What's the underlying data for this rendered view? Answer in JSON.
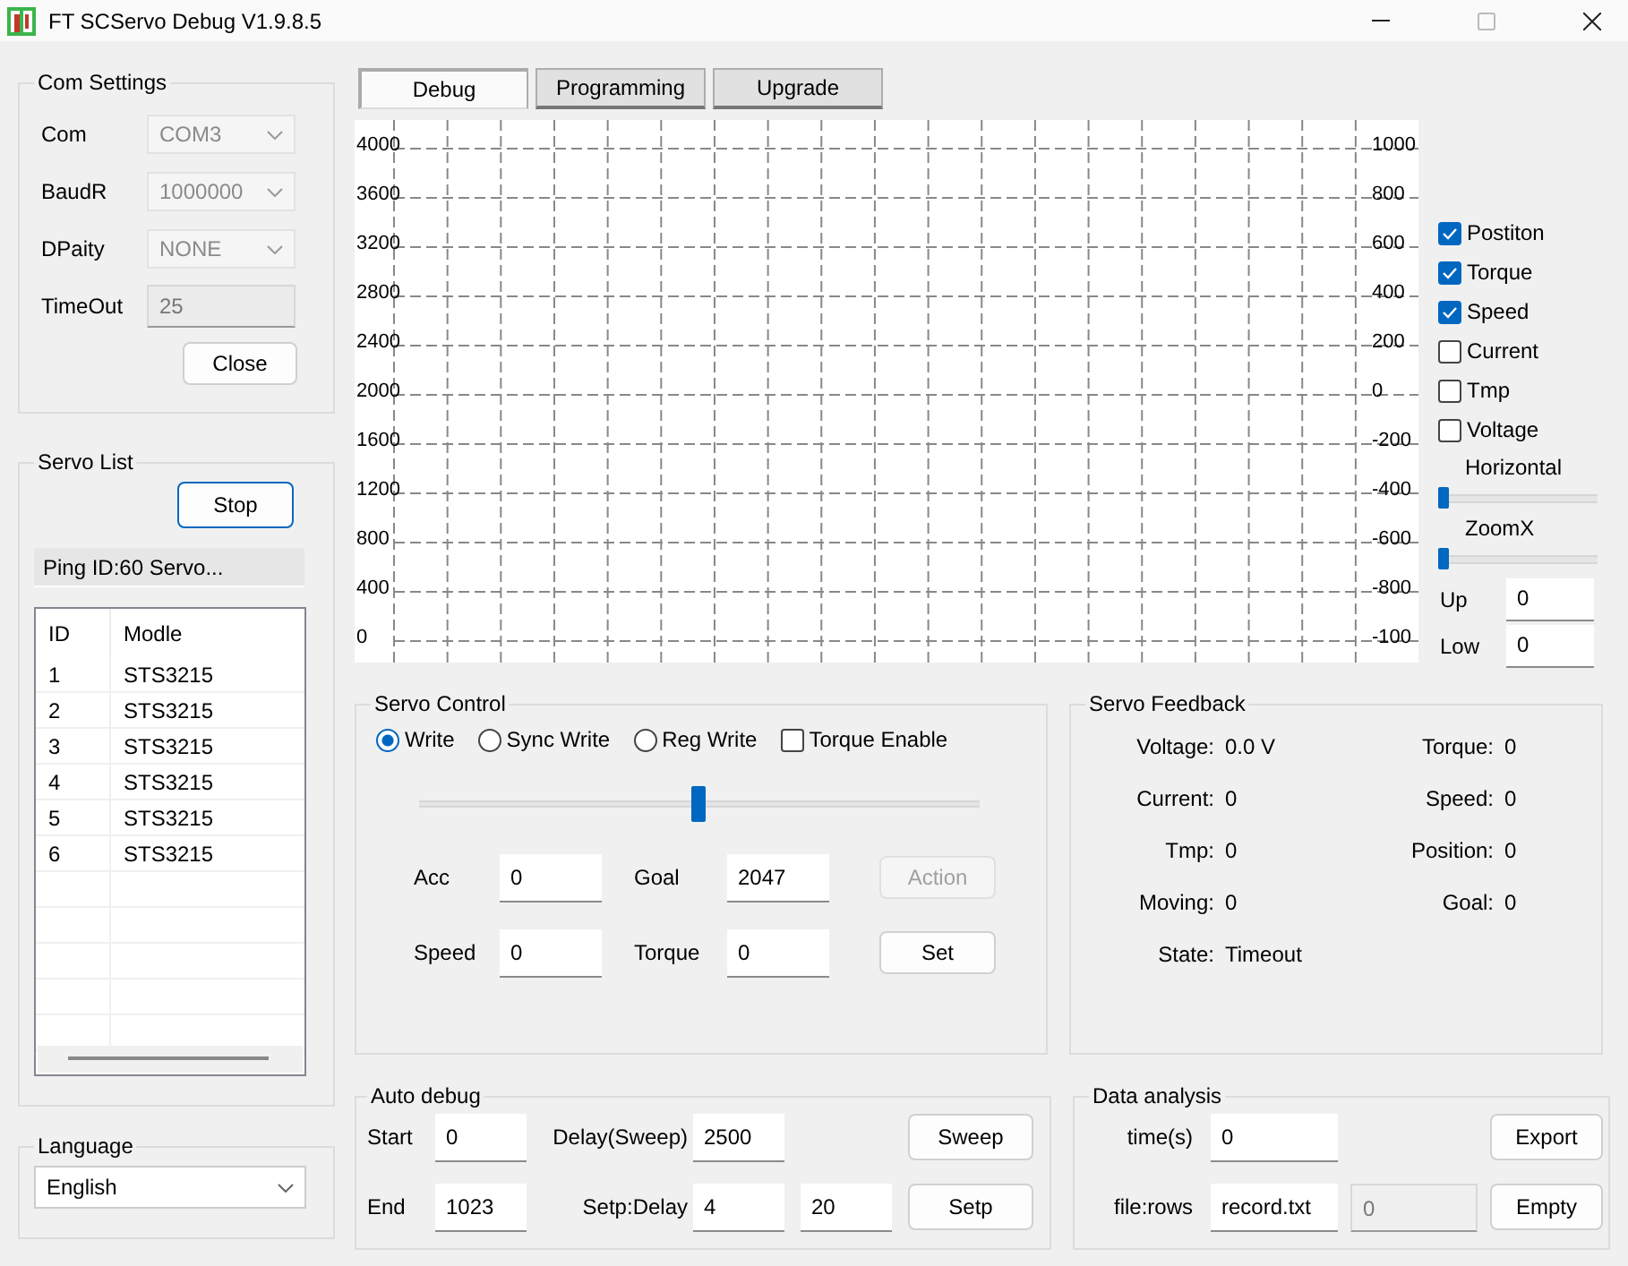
{
  "window": {
    "title": "FT SCServo Debug V1.9.8.5"
  },
  "com_settings": {
    "title": "Com Settings",
    "fields": [
      {
        "label": "Com",
        "value": "COM3",
        "kind": "select",
        "disabled": true
      },
      {
        "label": "BaudR",
        "value": "1000000",
        "kind": "select",
        "disabled": true
      },
      {
        "label": "DPaity",
        "value": "NONE",
        "kind": "select",
        "disabled": true
      },
      {
        "label": "TimeOut",
        "value": "25",
        "kind": "text",
        "disabled": true
      }
    ],
    "button": "Close"
  },
  "servo_list": {
    "title": "Servo List",
    "button": "Stop",
    "status": "Ping ID:60 Servo...",
    "columns": [
      "ID",
      "Modle"
    ],
    "rows": [
      [
        "1",
        "STS3215"
      ],
      [
        "2",
        "STS3215"
      ],
      [
        "3",
        "STS3215"
      ],
      [
        "4",
        "STS3215"
      ],
      [
        "5",
        "STS3215"
      ],
      [
        "6",
        "STS3215"
      ]
    ]
  },
  "language": {
    "title": "Language",
    "value": "English"
  },
  "tabs": [
    {
      "label": "Debug",
      "selected": true
    },
    {
      "label": "Programming",
      "selected": false
    },
    {
      "label": "Upgrade",
      "selected": false
    }
  ],
  "chart": {
    "left_axis_labels": [
      "4000",
      "3600",
      "3200",
      "2800",
      "2400",
      "2000",
      "1600",
      "1200",
      "800",
      "400",
      "0"
    ],
    "right_axis_labels": [
      "1000",
      "800",
      "600",
      "400",
      "200",
      "0",
      "-200",
      "-400",
      "-600",
      "-800",
      "-100"
    ]
  },
  "plot_options": {
    "checkboxes": [
      {
        "label": "Postiton",
        "checked": true
      },
      {
        "label": "Torque",
        "checked": true
      },
      {
        "label": "Speed",
        "checked": true
      },
      {
        "label": "Current",
        "checked": false
      },
      {
        "label": "Tmp",
        "checked": false
      },
      {
        "label": "Voltage",
        "checked": false
      }
    ],
    "sliders": [
      {
        "label": "Horizontal",
        "level": 0
      },
      {
        "label": "ZoomX",
        "level": 0
      }
    ],
    "fields": [
      {
        "label": "Up",
        "value": "0"
      },
      {
        "label": "Low",
        "value": "0"
      }
    ]
  },
  "servo_control": {
    "title": "Servo Control",
    "modes": [
      {
        "label": "Write",
        "selected": true
      },
      {
        "label": "Sync Write",
        "selected": false
      },
      {
        "label": "Reg Write",
        "selected": false
      }
    ],
    "torque_enable": {
      "label": "Torque Enable",
      "checked": false
    },
    "slider": {
      "level": 0.5
    },
    "rows": [
      {
        "fields": [
          {
            "label": "Acc",
            "value": "0"
          },
          {
            "label": "Goal",
            "value": "2047"
          }
        ],
        "button": {
          "label": "Action",
          "disabled": true
        }
      },
      {
        "fields": [
          {
            "label": "Speed",
            "value": "0"
          },
          {
            "label": "Torque",
            "value": "0"
          }
        ],
        "button": {
          "label": "Set",
          "disabled": false
        }
      }
    ]
  },
  "servo_feedback": {
    "title": "Servo Feedback",
    "items": [
      {
        "label": "Voltage:",
        "value": "0.0 V"
      },
      {
        "label": "Torque:",
        "value": "0"
      },
      {
        "label": "Current:",
        "value": "0"
      },
      {
        "label": "Speed:",
        "value": "0"
      },
      {
        "label": "Tmp:",
        "value": "0"
      },
      {
        "label": "Position:",
        "value": "0"
      },
      {
        "label": "Moving:",
        "value": "0"
      },
      {
        "label": "Goal:",
        "value": "0"
      },
      {
        "label": "State:",
        "value": "Timeout"
      }
    ]
  },
  "auto_debug": {
    "title": "Auto debug",
    "rows": [
      {
        "label": "Start",
        "value": "0",
        "label2": "Delay(Sweep)",
        "values2": [
          "2500"
        ],
        "button": "Sweep"
      },
      {
        "label": "End",
        "value": "1023",
        "label2": "Setp:Delay",
        "values2": [
          "4",
          "20"
        ],
        "button": "Setp"
      }
    ]
  },
  "data_analysis": {
    "title": "Data analysis",
    "rows": [
      {
        "label": "time(s)",
        "fields": [
          {
            "value": "0",
            "disabled": false
          }
        ],
        "button": "Export"
      },
      {
        "label": "file:rows",
        "fields": [
          {
            "value": "record.txt",
            "disabled": false
          },
          {
            "value": "0",
            "disabled": true
          }
        ],
        "button": "Empty"
      }
    ]
  }
}
